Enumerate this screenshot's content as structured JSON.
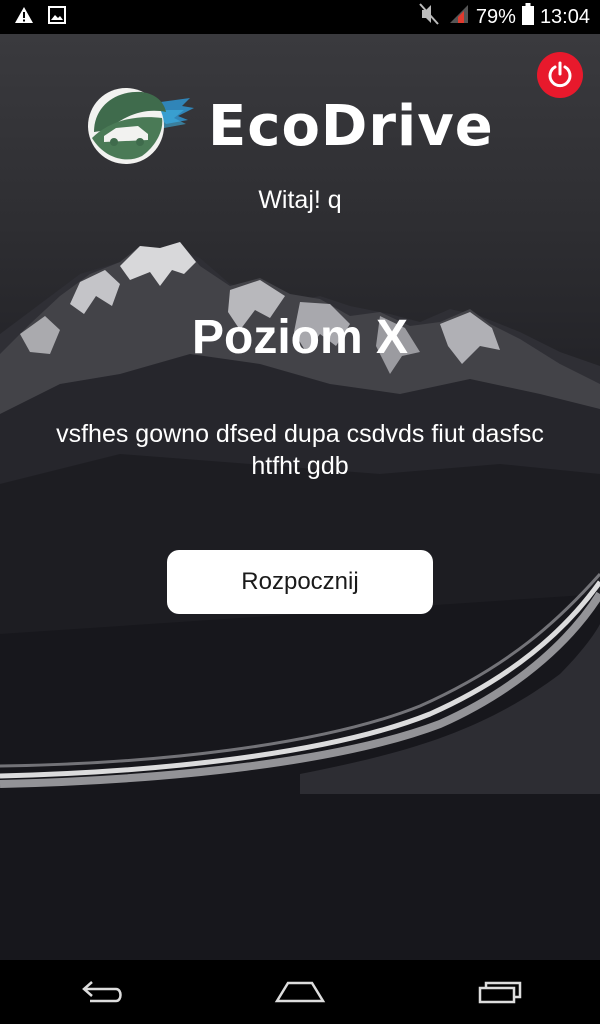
{
  "status_bar": {
    "battery": "79%",
    "time": "13:04"
  },
  "app": {
    "logo_text": "EcoDrive",
    "greeting": "Witaj! q",
    "level_title": "Poziom X",
    "description": "vsfhes gowno dfsed dupa csdvds fiut dasfsc htfht gdb",
    "start_button": "Rozpocznij"
  },
  "colors": {
    "accent_power": "#e8192c",
    "logo_green": "#3f6b4c",
    "logo_blue": "#2f9ad8"
  },
  "icons": {
    "status_left": [
      "warning-icon",
      "image-icon"
    ],
    "status_right": [
      "mute-icon",
      "signal-icon",
      "battery-icon"
    ],
    "nav": [
      "back-icon",
      "home-icon",
      "recents-icon"
    ]
  }
}
